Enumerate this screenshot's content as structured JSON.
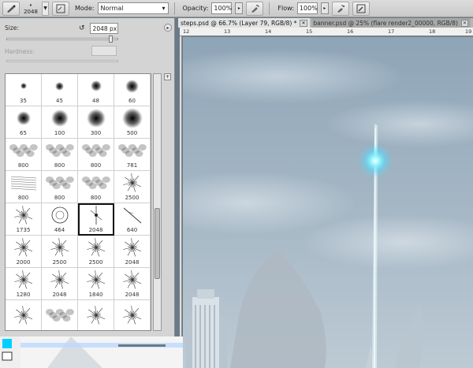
{
  "optbar": {
    "brush_size": "2048",
    "mode_label": "Mode:",
    "mode_value": "Normal",
    "opacity_label": "Opacity:",
    "opacity_value": "100%",
    "flow_label": "Flow:",
    "flow_value": "100%"
  },
  "panel": {
    "size_label": "Size:",
    "size_value": "2048 px",
    "size_fraction": 0.95,
    "hardness_label": "Hardness:",
    "presets": [
      {
        "label": "35",
        "kind": "soft",
        "d": 8
      },
      {
        "label": "45",
        "kind": "soft",
        "d": 11
      },
      {
        "label": "48",
        "kind": "soft",
        "d": 14
      },
      {
        "label": "60",
        "kind": "soft",
        "d": 17
      },
      {
        "label": "65",
        "kind": "soft",
        "d": 18
      },
      {
        "label": "100",
        "kind": "soft",
        "d": 22
      },
      {
        "label": "300",
        "kind": "soft",
        "d": 24
      },
      {
        "label": "500",
        "kind": "soft",
        "d": 26
      },
      {
        "label": "800",
        "kind": "cloud"
      },
      {
        "label": "800",
        "kind": "cloud"
      },
      {
        "label": "800",
        "kind": "cloud"
      },
      {
        "label": "781",
        "kind": "cloud"
      },
      {
        "label": "800",
        "kind": "streak"
      },
      {
        "label": "800",
        "kind": "cloud"
      },
      {
        "label": "800",
        "kind": "cloud"
      },
      {
        "label": "2500",
        "kind": "burst"
      },
      {
        "label": "1735",
        "kind": "burst"
      },
      {
        "label": "464",
        "kind": "ring"
      },
      {
        "label": "2048",
        "kind": "spark",
        "selected": true
      },
      {
        "label": "640",
        "kind": "line"
      },
      {
        "label": "2000",
        "kind": "burst"
      },
      {
        "label": "2500",
        "kind": "burst"
      },
      {
        "label": "2500",
        "kind": "burst"
      },
      {
        "label": "2048",
        "kind": "burst"
      },
      {
        "label": "1280",
        "kind": "burst"
      },
      {
        "label": "2048",
        "kind": "burst"
      },
      {
        "label": "1840",
        "kind": "burst"
      },
      {
        "label": "2048",
        "kind": "burst"
      },
      {
        "label": "",
        "kind": "burst"
      },
      {
        "label": "",
        "kind": "cloud"
      },
      {
        "label": "",
        "kind": "burst"
      },
      {
        "label": "",
        "kind": "burst"
      }
    ]
  },
  "tabs": [
    {
      "label": "steps.psd @ 66.7% (Layer 79, RGB/8) *",
      "active": true
    },
    {
      "label": "banner.psd @ 25% (flare render2_00000, RGB/8)",
      "active": false
    }
  ],
  "ruler": [
    "12",
    "13",
    "14",
    "15",
    "16",
    "17",
    "18",
    "19"
  ],
  "colors": {
    "sky_top": "#8fa6b8",
    "sky_bottom": "#b3c3cf",
    "glow": "#6ff0ff"
  }
}
